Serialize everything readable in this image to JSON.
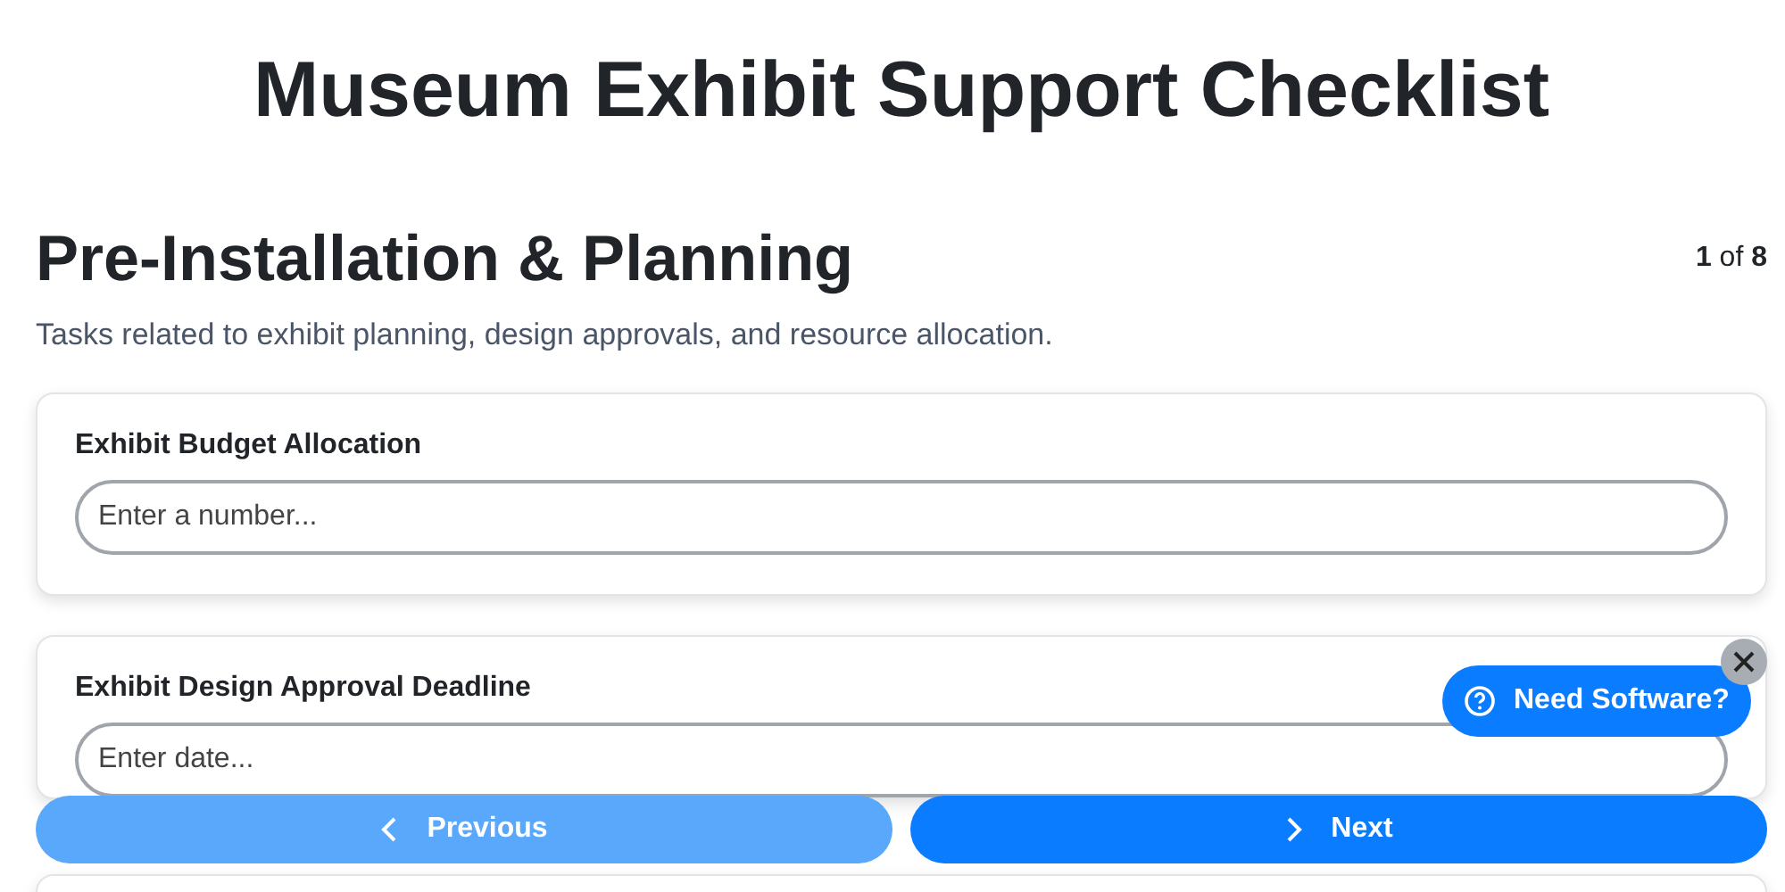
{
  "title": "Museum Exhibit Support Checklist",
  "section": {
    "title": "Pre-Installation & Planning",
    "page": "1",
    "page_total": "8",
    "page_sep": "of",
    "description": "Tasks related to exhibit planning, design approvals, and resource allocation."
  },
  "fields": [
    {
      "label": "Exhibit Budget Allocation",
      "placeholder": "Enter a number..."
    },
    {
      "label": "Exhibit Design Approval Deadline",
      "placeholder": "Enter date..."
    }
  ],
  "nav": [
    {
      "kind": "previous",
      "label": "Previous",
      "disabled": true
    },
    {
      "kind": "next",
      "label": "Next",
      "disabled": false
    }
  ],
  "help": {
    "label": "Need Software?"
  }
}
